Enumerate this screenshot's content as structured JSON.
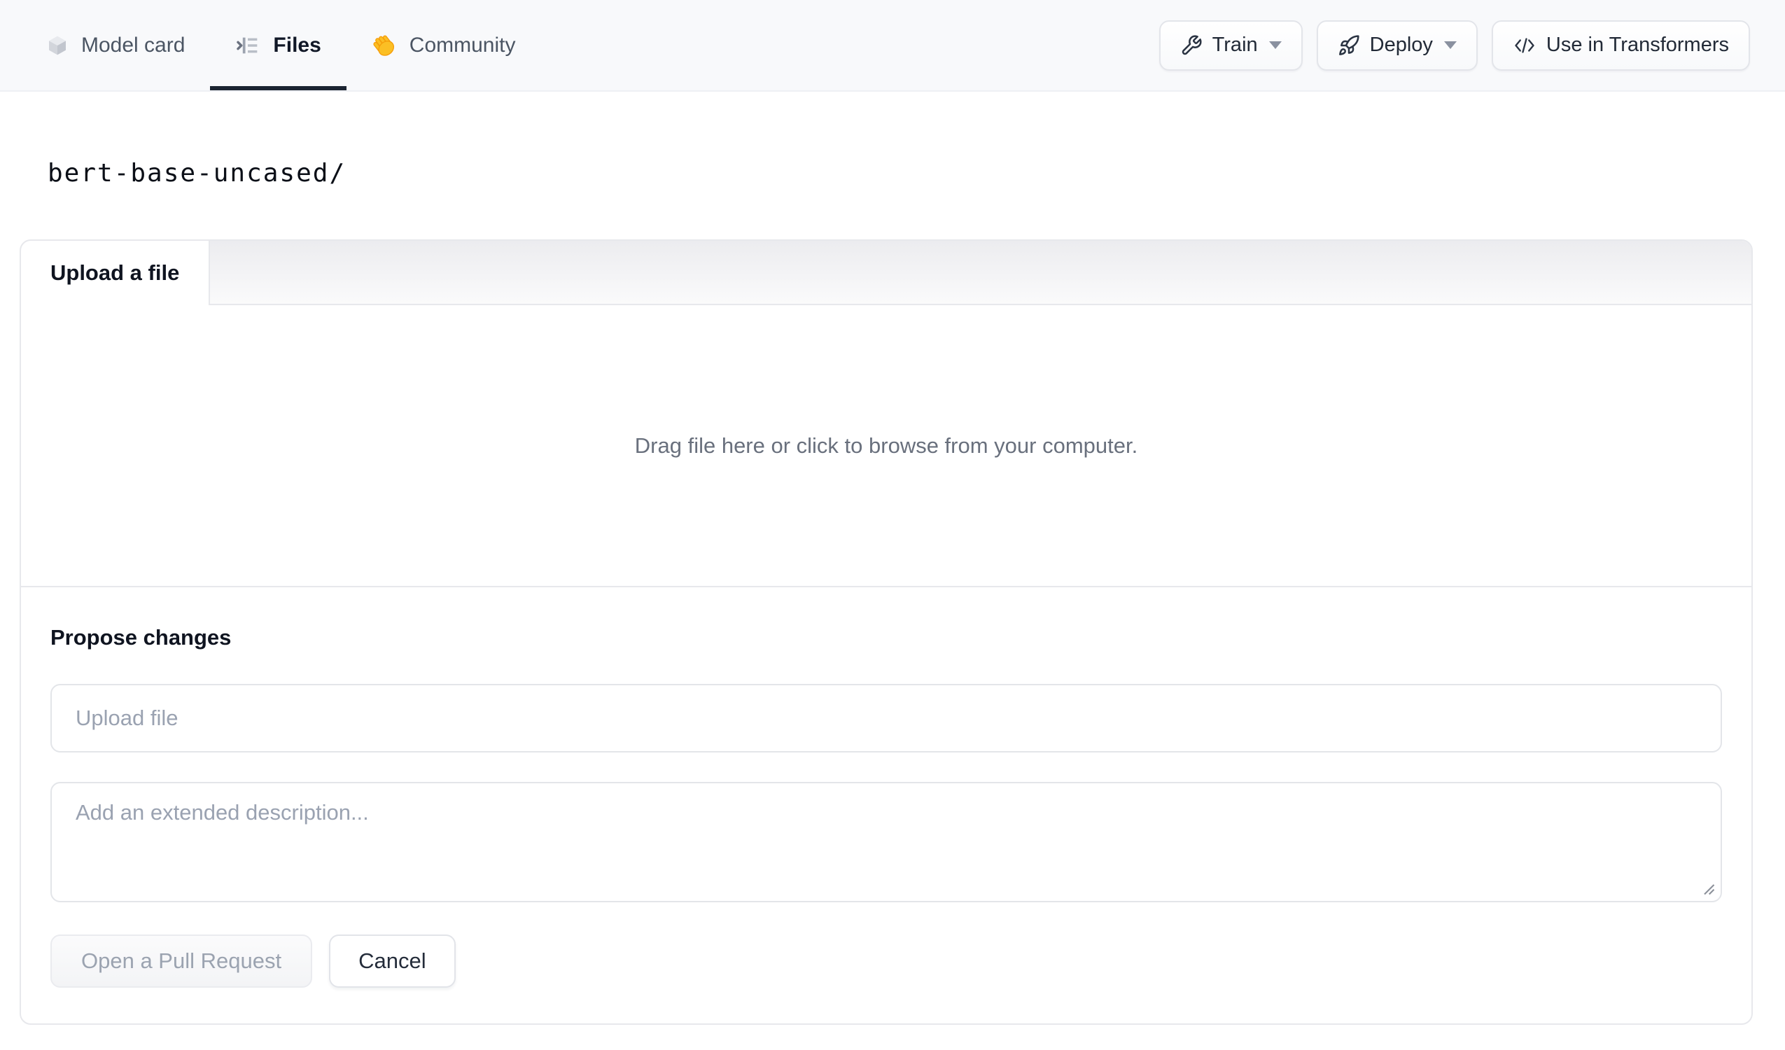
{
  "header": {
    "tabs": [
      {
        "label": "Model card",
        "icon": "cube-icon",
        "active": false
      },
      {
        "label": "Files",
        "icon": "files-list-icon",
        "active": true
      },
      {
        "label": "Community",
        "icon": "waving-hand-icon",
        "active": false
      }
    ],
    "actions": [
      {
        "label": "Train",
        "icon": "wrench-icon",
        "has_caret": true
      },
      {
        "label": "Deploy",
        "icon": "rocket-icon",
        "has_caret": true
      },
      {
        "label": "Use in Transformers",
        "icon": "code-icon",
        "has_caret": false
      }
    ]
  },
  "breadcrumb": {
    "path": "bert-base-uncased/"
  },
  "upload_panel": {
    "tab_label": "Upload a file",
    "dropzone_text": "Drag file here or click to browse from your computer.",
    "propose_heading": "Propose changes",
    "filename_placeholder": "Upload file",
    "description_placeholder": "Add an extended description...",
    "submit_label": "Open a Pull Request",
    "cancel_label": "Cancel"
  },
  "colors": {
    "active_tab_underline": "#1b2431",
    "header_background": "#f8f9fb",
    "muted_text": "#69707d",
    "placeholder_text": "#9aa2b1"
  }
}
